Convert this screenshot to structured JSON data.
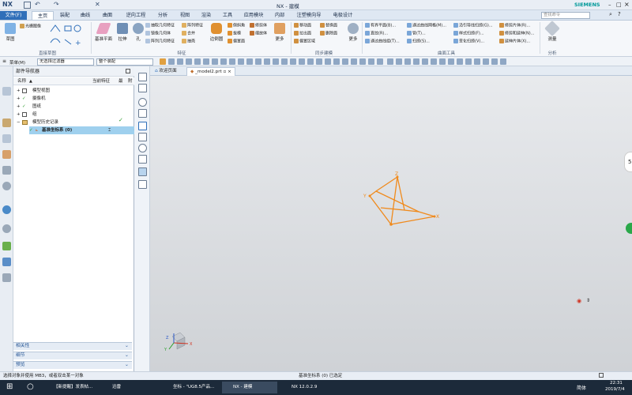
{
  "app": {
    "logo": "NX",
    "title": "NX - 建模",
    "brand": "SIEMENS",
    "search_placeholder": "查找命令"
  },
  "menu": {
    "file": "文件(F)",
    "items": [
      "主页",
      "装配",
      "曲线",
      "曲面",
      "逆向工程",
      "分析",
      "视图",
      "渲染",
      "工具",
      "应用模块",
      "内部",
      "注塑模向导",
      "电极设计"
    ],
    "active_index": 0
  },
  "ribbon": {
    "groups": [
      {
        "label": "直接草图",
        "big": [
          "草图"
        ],
        "small": [
          "光栅图像"
        ]
      },
      {
        "label": "特征",
        "big": [
          "基准平面",
          "拉伸",
          "孔",
          "边倒圆",
          "更多"
        ],
        "small": [
          "抽取几何特征",
          "镜像几何体",
          "阵列几何特征",
          "阵列特征",
          "合并",
          "抽壳",
          "倒斜角",
          "拔模",
          "偏置面",
          "修剪体",
          "缩放体",
          "替换面"
        ]
      },
      {
        "label": "同步建模",
        "big": [
          "更多"
        ],
        "small": [
          "移动面",
          "拉出面",
          "偏置区域",
          "替换面",
          "删除面"
        ]
      },
      {
        "label": "曲面工具",
        "big": [],
        "small": [
          "有界平面(B)...",
          "直纹(R)...",
          "通过曲线组(T)...",
          "通过曲线网格(M)...",
          "管(T)...",
          "扫掠(S)...",
          "沿引导线扫掠(G)...",
          "样式扫掠(F)...",
          "变化扫掠(V)...",
          "修剪片体(R)...",
          "修剪和延伸(N)...",
          "延伸片体(X)..."
        ]
      },
      {
        "label": "分析",
        "big": [
          "测量"
        ],
        "small": []
      }
    ]
  },
  "filterbar": {
    "menu": "菜单(M)",
    "filter": "无选择过滤器",
    "scope": "整个装配"
  },
  "navigator": {
    "title": "部件导航器",
    "columns": [
      "名称",
      "当前特征",
      "最",
      "附"
    ],
    "rows": [
      {
        "label": "模型视图",
        "expanded": false
      },
      {
        "label": "摄像机",
        "expanded": false
      },
      {
        "label": "图纸",
        "expanded": false
      },
      {
        "label": "组",
        "expanded": false
      },
      {
        "label": "模型历史记录",
        "expanded": true
      },
      {
        "label": "基准坐标系 (0)",
        "expanded": false,
        "selected": true
      }
    ],
    "sections": [
      "相关性",
      "细节",
      "预览"
    ]
  },
  "tabs": [
    {
      "label": "欢迎页面"
    },
    {
      "label": "_model2.prt",
      "active": true
    }
  ],
  "viewport": {
    "triad": {
      "x": "X",
      "y": "Y",
      "z": "Z"
    },
    "side_badge": "5"
  },
  "status": {
    "left": "选择对象并使用 MB3，或者双击某一对象",
    "center": "基准坐标系 (0) 已选定"
  },
  "taskbar": {
    "items": [
      "【新提醒】发表帖...",
      "迅雷",
      "坐标 - \"UG8.5产品...",
      "NX - 建模",
      "NX 12.0.2.9"
    ],
    "active_index": 3,
    "time": "22:31",
    "date": "2019/7/4",
    "ime": "简体"
  },
  "colors": {
    "accent": "#2f6fb9",
    "selection": "#9fd0ee",
    "csys": "#f08a1c"
  }
}
